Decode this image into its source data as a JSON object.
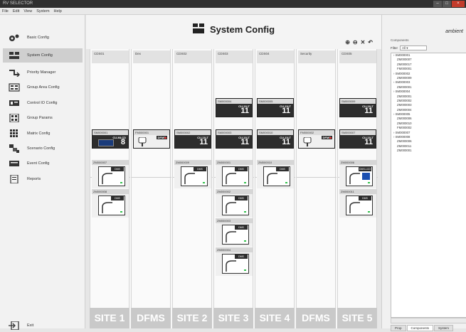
{
  "window": {
    "title": "RV SELECTOR"
  },
  "menu": [
    "File",
    "Edit",
    "View",
    "System",
    "Help"
  ],
  "sidebar": {
    "items": [
      {
        "label": "Basic Config",
        "icon": "gears-icon"
      },
      {
        "label": "System Config",
        "icon": "system-config-icon",
        "active": true
      },
      {
        "label": "Priority Manager",
        "icon": "priority-icon"
      },
      {
        "label": "Group Area Config",
        "icon": "group-area-icon"
      },
      {
        "label": "Control IO Config",
        "icon": "control-io-icon"
      },
      {
        "label": "Group Params",
        "icon": "group-params-icon"
      },
      {
        "label": "Matrix Config",
        "icon": "matrix-icon"
      },
      {
        "label": "Scenario Config",
        "icon": "scenario-icon"
      },
      {
        "label": "Event Config",
        "icon": "event-icon"
      },
      {
        "label": "Reports",
        "icon": "reports-icon"
      }
    ],
    "exit_label": "Exit"
  },
  "header": {
    "title": "System Config"
  },
  "columns": [
    {
      "name": "CDS01",
      "site": "SITE 1"
    },
    {
      "name": "Dex",
      "site": "DFMS"
    },
    {
      "name": "CDS02",
      "site": "SITE 2"
    },
    {
      "name": "CDS03",
      "site": "SITE 3"
    },
    {
      "name": "CDS04",
      "site": "SITE 4"
    },
    {
      "name": "Security",
      "site": "DFMS"
    },
    {
      "name": "CDS05",
      "site": "SITE 5"
    }
  ],
  "devices": {
    "upper_cus": [
      {
        "col": 3,
        "id": "SM000004",
        "label": "CU-11LT",
        "num": "11"
      },
      {
        "col": 4,
        "id": "SM000005",
        "label": "CU-11LT",
        "num": "11"
      },
      {
        "col": 6,
        "id": "SM000009",
        "label": "CU-11LT",
        "num": "11"
      }
    ],
    "lower_cus": [
      {
        "col": 0,
        "id": "SM000001",
        "label": "CU-MLCD",
        "num": "8",
        "screen": true
      },
      {
        "col": 2,
        "id": "SM000002",
        "label": "CU-11LT",
        "num": "11"
      },
      {
        "col": 3,
        "id": "SM000003",
        "label": "CU-11LT",
        "num": "11"
      },
      {
        "col": 4,
        "id": "SM000010",
        "label": "CU-11LT",
        "num": "11"
      },
      {
        "col": 6,
        "id": "SM000007",
        "label": "CU-11LT",
        "num": "11"
      }
    ],
    "dfms": [
      {
        "col": 1,
        "id": "FM000001",
        "label": "DFMS"
      },
      {
        "col": 5,
        "id": "FM000002",
        "label": "DFMS"
      }
    ],
    "dms": [
      {
        "col": 0,
        "row": 0,
        "id": "ZM000007",
        "label": "DMS"
      },
      {
        "col": 0,
        "row": 1,
        "id": "ZM000008",
        "label": "DMS"
      },
      {
        "col": 2,
        "row": 0,
        "id": "ZM000009",
        "label": "DMS"
      },
      {
        "col": 3,
        "row": 0,
        "id": "ZM000001",
        "label": "DMS"
      },
      {
        "col": 3,
        "row": 1,
        "id": "ZM000002",
        "label": "DMS"
      },
      {
        "col": 3,
        "row": 2,
        "id": "ZM000003",
        "label": "DMS"
      },
      {
        "col": 3,
        "row": 3,
        "id": "ZM000004",
        "label": "DMS"
      },
      {
        "col": 4,
        "row": 0,
        "id": "ZM000010",
        "label": "DMS"
      },
      {
        "col": 6,
        "row": 0,
        "id": "ZM000006",
        "label": "DMS-LCD",
        "screen": true
      },
      {
        "col": 6,
        "row": 1,
        "id": "ZM000011",
        "label": "DMS"
      }
    ]
  },
  "right_panel": {
    "logo": "ambient",
    "title": "Components",
    "filter_label": "Filter",
    "filter_value": "All",
    "items": [
      "SM000001",
      "ZM000007",
      "ZM000017",
      "FM000001",
      "SM000002",
      "ZM000009",
      "SM000003",
      "ZM000001",
      "SM000004",
      "ZM000001",
      "ZM000002",
      "ZM000003",
      "ZM000004",
      "SM000005",
      "ZM000006",
      "ZM000010",
      "FM000002",
      "SM000007",
      "SM000008",
      "ZM000006",
      "ZM000011",
      "ZM000001"
    ],
    "tabs": [
      "Prop",
      "Components",
      "System"
    ]
  }
}
